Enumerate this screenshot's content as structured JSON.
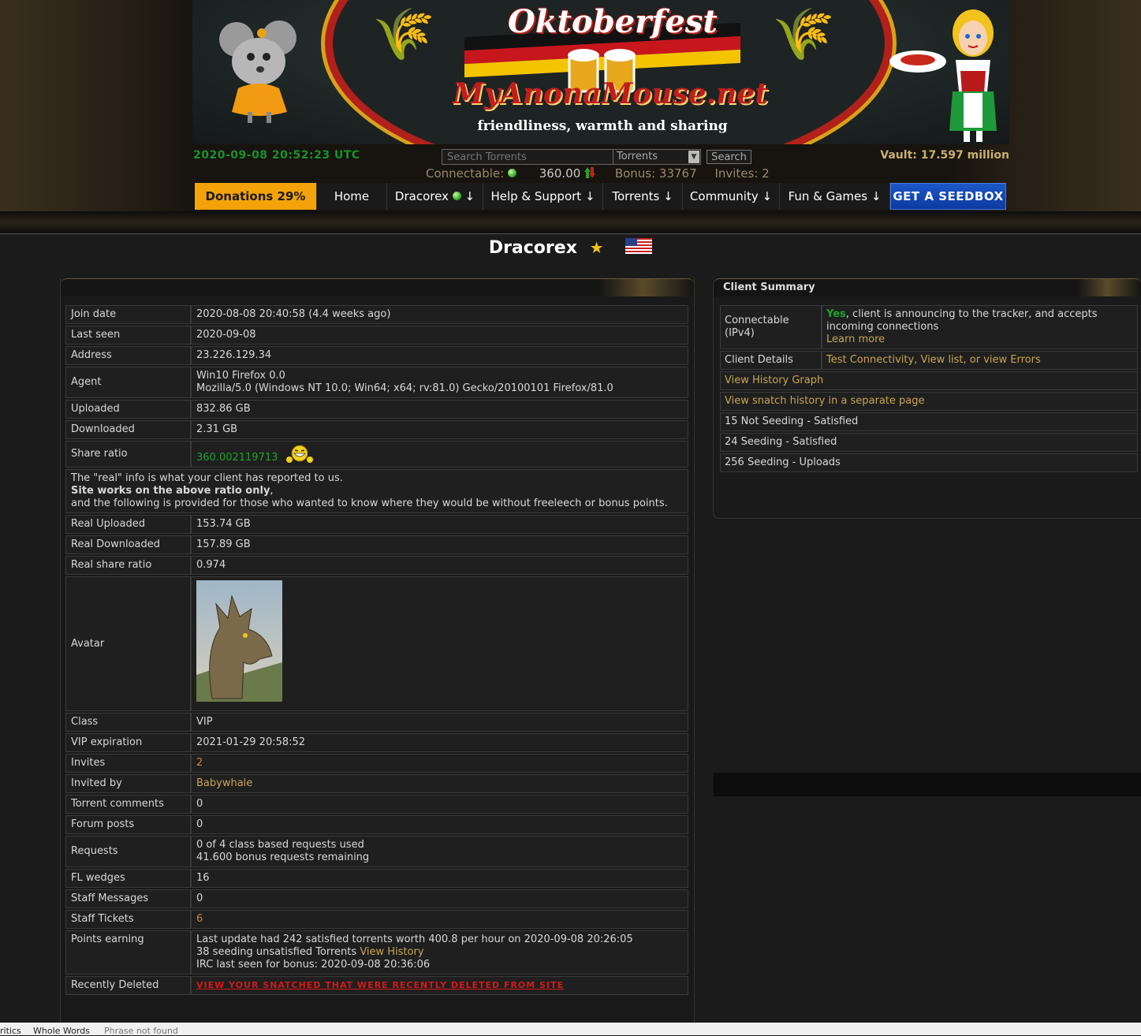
{
  "header": {
    "banner": {
      "event_title": "Oktoberfest",
      "site_name": "MyAnonaMouse.net",
      "tagline": "friendliness, warmth and sharing"
    },
    "clock": "2020-09-08 20:52:23 UTC",
    "vault": "Vault: 17.597 million",
    "search": {
      "placeholder": "Search Torrents",
      "category_selected": "Torrents",
      "button_label": "Search"
    },
    "stats": {
      "connectable_label": "Connectable:",
      "ratio": "360.00",
      "bonus": "Bonus: 33767",
      "invites": "Invites: 2"
    }
  },
  "nav": {
    "donations": "Donations 29%",
    "home": "Home",
    "user": "Dracorex",
    "user_arrow": "↓",
    "help": "Help & Support ↓",
    "torrents": "Torrents ↓",
    "community": "Community ↓",
    "fun": "Fun & Games ↓",
    "seedbox": "GET A SEEDBOX"
  },
  "profile": {
    "username": "Dracorex",
    "star": "★",
    "rows": [
      {
        "label": "Join date",
        "value": "2020-08-08 20:40:58 (4.4 weeks ago)"
      },
      {
        "label": "Last seen",
        "value": "2020-09-08"
      },
      {
        "label": "Address",
        "value": "23.226.129.34"
      },
      {
        "label": "Agent",
        "value": "Win10 Firefox 0.0",
        "value2": "Mozilla/5.0 (Windows NT 10.0; Win64; x64; rv:81.0) Gecko/20100101 Firefox/81.0"
      },
      {
        "label": "Uploaded",
        "value": "832.86 GB"
      },
      {
        "label": "Downloaded",
        "value": "2.31 GB"
      },
      {
        "label": "Share ratio",
        "value": "360.002119713"
      }
    ],
    "real_note": {
      "line1": "The \"real\" info is what your client has reported to us.",
      "line2_bold": "Site works on the above ratio only",
      "line2_rest": ",",
      "line3": "and the following is provided for those who wanted to know where they would be without freeleech or bonus points."
    },
    "real_rows": [
      {
        "label": "Real Uploaded",
        "value": "153.74 GB"
      },
      {
        "label": "Real Downloaded",
        "value": "157.89 GB"
      },
      {
        "label": "Real share ratio",
        "value": "0.974"
      }
    ],
    "avatar_label": "Avatar",
    "lower_rows": [
      {
        "label": "Class",
        "value": "VIP"
      },
      {
        "label": "VIP expiration",
        "value": "2021-01-29 20:58:52"
      },
      {
        "label": "Invites",
        "value": "2"
      },
      {
        "label": "Invited by",
        "value": "Babywhale"
      },
      {
        "label": "Torrent comments",
        "value": "0"
      },
      {
        "label": "Forum posts",
        "value": "0"
      }
    ],
    "requests": {
      "label": "Requests",
      "line1": "0 of 4 class based requests used",
      "line2": "41.600 bonus requests remaining"
    },
    "fl_wedges": {
      "label": "FL wedges",
      "value": "16"
    },
    "staff_messages": {
      "label": "Staff Messages",
      "value": "0"
    },
    "staff_tickets": {
      "label": "Staff Tickets",
      "value": "6"
    },
    "points": {
      "label": "Points earning",
      "line1": "Last update had 242 satisfied torrents worth 400.8 per hour on 2020-09-08 20:26:05",
      "line2_text": "38 seeding unsatisfied Torrents",
      "line2_link": "View History",
      "line3": "IRC last seen for bonus: 2020-09-08 20:36:06"
    },
    "recently_deleted": {
      "label": "Recently Deleted",
      "link": "View your snatched that were recently deleted from site"
    }
  },
  "client_summary": {
    "title": "Client Summary",
    "connectable_label": "Connectable (IPv4)",
    "connectable_yes": "Yes",
    "connectable_text": ", client is announcing to the tracker, and accepts incoming connections",
    "learn_more": "Learn more",
    "client_details_label": "Client Details",
    "client_details_link": "Test Connectivity, View list, or view Errors",
    "history_graph": "View History Graph",
    "snatch_history": "View snatch history in a separate page",
    "not_seeding": "15 Not Seeding - Satisfied",
    "seeding": "24 Seeding - Satisfied",
    "uploads": "256 Seeding - Uploads"
  },
  "find_bar": {
    "item1": "ritics",
    "item2": "Whole Words",
    "item3": "Phrase not found"
  },
  "colors": {
    "accent_orange": "#f4a20a",
    "seedbox_blue": "#1d57c8",
    "clock_green": "#18922a",
    "link_gold": "#c9a451"
  }
}
